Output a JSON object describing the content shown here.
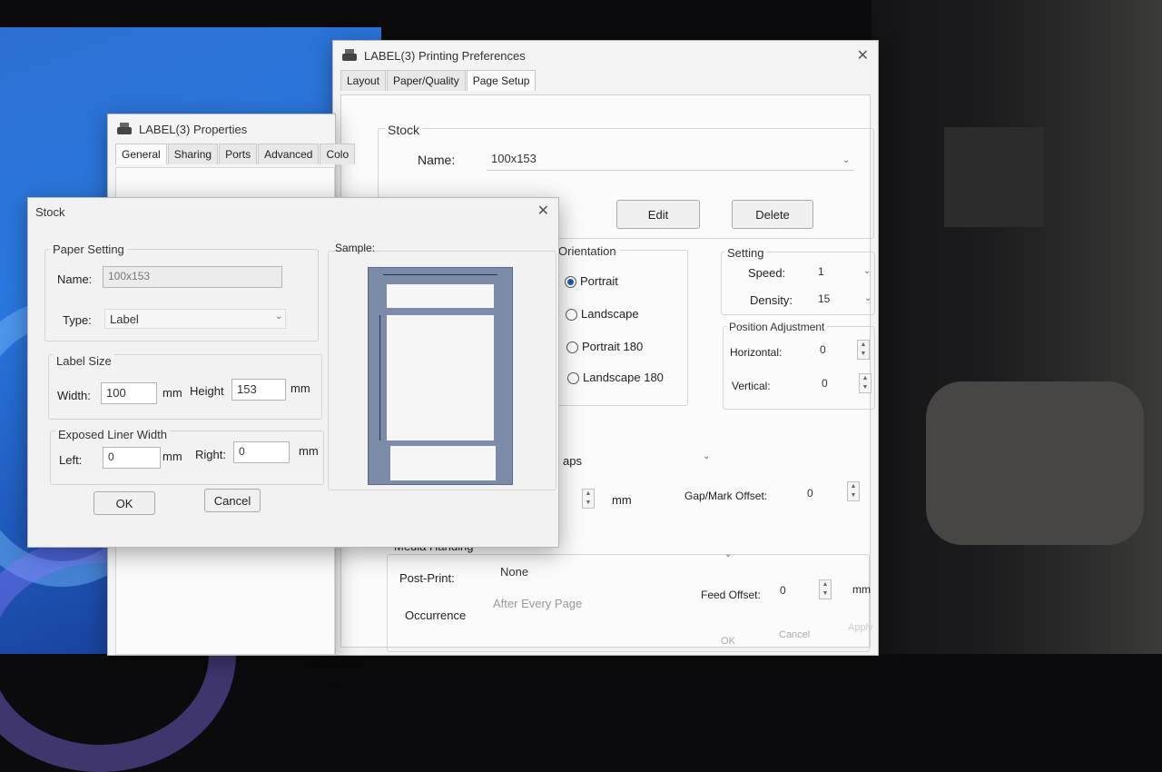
{
  "prefs": {
    "title": "LABEL(3) Printing Preferences",
    "tabs": [
      "Layout",
      "Paper/Quality",
      "Page Setup"
    ],
    "stock_group": "Stock",
    "name_label": "Name:",
    "name_value": "100x153",
    "edit_button": "Edit",
    "delete_button": "Delete",
    "orientation_title": "Orientation",
    "orientations": [
      "Portrait",
      "Landscape",
      "Portrait 180",
      "Landscape 180"
    ],
    "setting_title": "Setting",
    "speed_label": "Speed:",
    "speed_value": "1",
    "density_label": "Density:",
    "density_value": "15",
    "position_title": "Position Adjustment",
    "horizontal_label": "Horizontal:",
    "horizontal_value": "0",
    "vertical_label": "Vertical:",
    "vertical_value": "0",
    "media_type_partial": "aps",
    "mm_unit": "mm",
    "gap_label": "Gap/Mark Offset:",
    "gap_value": "0",
    "media_handling_title": "Media Handing",
    "post_print_label": "Post-Print:",
    "post_print_value": "None",
    "occurrence_label": "Occurrence",
    "occurrence_value": "After Every Page",
    "feed_offset_label": "Feed Offset:",
    "feed_offset_value": "0",
    "ok_button": "OK",
    "cancel_button": "Cancel",
    "apply_button": "Apply"
  },
  "props": {
    "title": "LABEL(3) Properties",
    "tabs": [
      "General",
      "Sharing",
      "Ports",
      "Advanced",
      "Colo"
    ]
  },
  "stock": {
    "title": "Stock",
    "paper_setting_title": "Paper Setting",
    "name_label": "Name:",
    "name_value": "100x153",
    "type_label": "Type:",
    "type_value": "Label",
    "label_size_title": "Label Size",
    "width_label": "Width:",
    "width_value": "100",
    "mm1": "mm",
    "height_label": "Height",
    "height_value": "153",
    "mm2": "mm",
    "liner_title": "Exposed Liner Width",
    "left_label": "Left:",
    "left_value": "0",
    "mm3": "mm",
    "right_label": "Right:",
    "right_value": "0",
    "mm4": "mm",
    "sample_label": "Sample:",
    "ok_button": "OK",
    "cancel_button": "Cancel"
  },
  "colors": {
    "desktop_blue": "#2a78e0",
    "sample_frame": "#7b8ba8",
    "radio_selected": "#1a5fb4"
  }
}
